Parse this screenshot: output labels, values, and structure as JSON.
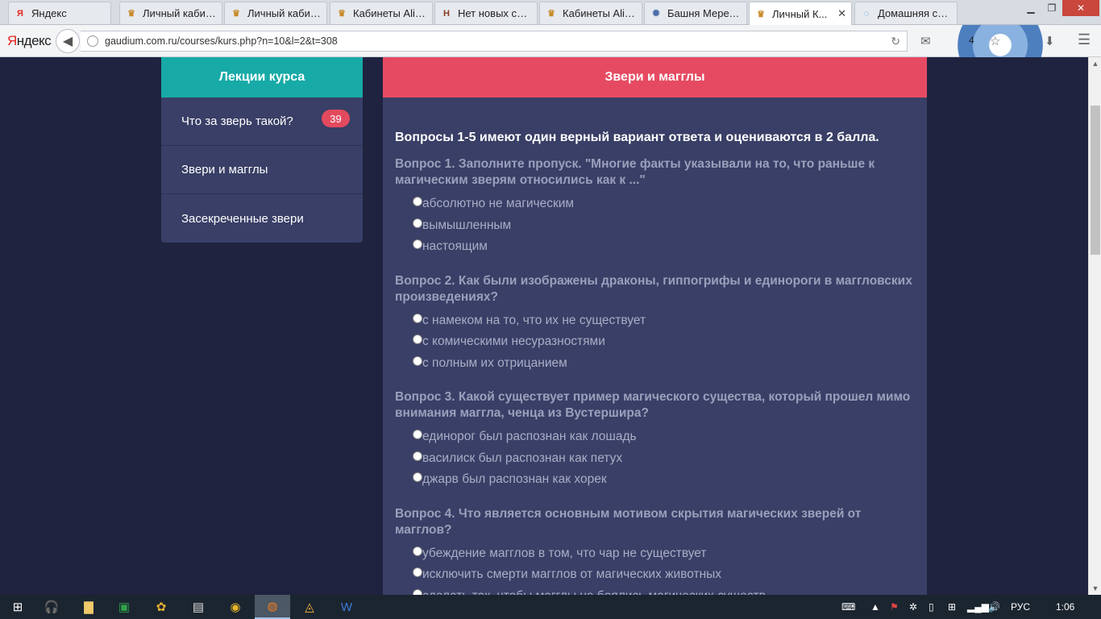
{
  "browser": {
    "tabs": [
      {
        "label": "Яндекс",
        "icon": "yandex-icon",
        "color": "#e52620",
        "glyph": "Я"
      },
      {
        "label": "Личный кабин...",
        "icon": "crest-icon",
        "color": "#c78a2a",
        "glyph": "♛"
      },
      {
        "label": "Личный кабин...",
        "icon": "crest-icon",
        "color": "#c78a2a",
        "glyph": "♛"
      },
      {
        "label": "Кабинеты Alic...",
        "icon": "crest-icon",
        "color": "#c78a2a",
        "glyph": "♛"
      },
      {
        "label": "Нет новых соо...",
        "icon": "shield-icon",
        "color": "#8a3a1e",
        "glyph": "H"
      },
      {
        "label": "Кабинеты Alic...",
        "icon": "crest-icon",
        "color": "#c78a2a",
        "glyph": "♛"
      },
      {
        "label": "Башня Меред...",
        "icon": "tower-icon",
        "color": "#4b6ea8",
        "glyph": "✺"
      },
      {
        "label": "Личный К...",
        "icon": "crest-icon",
        "color": "#c78a2a",
        "glyph": "♛",
        "active": true
      },
      {
        "label": "Домашняя стр...",
        "icon": "loading-icon",
        "color": "#3c8be0",
        "glyph": "◌"
      }
    ],
    "tab_close": "✕",
    "logo_first": "Я",
    "logo_rest": "ндекс",
    "url": "gaudium.com.ru/courses/kurs.php?n=10&l=2&t=308",
    "notification_count": "4"
  },
  "sidebar": {
    "title": "Лекции курса",
    "items": [
      {
        "label": "Что за зверь такой?",
        "badge": "39"
      },
      {
        "label": "Звери и магглы"
      },
      {
        "label": "Засекреченные звери"
      }
    ]
  },
  "main": {
    "title": "Звери и магглы",
    "intro": "Вопросы 1-5 имеют один верный вариант ответа и оцениваются в 2 балла.",
    "questions": [
      {
        "title": "Вопрос 1. Заполните пропуск. \"Многие факты указывали на то, что раньше к магическим зверям относились как к ...\"",
        "options": [
          "абсолютно не магическим",
          "вымышленным",
          "настоящим"
        ]
      },
      {
        "title": "Вопрос 2. Как были изображены драконы, гиппогрифы и единороги в маггловских произведениях?",
        "options": [
          "с намеком на то, что их не существует",
          "с комическими несуразностями",
          "с полным их отрицанием"
        ]
      },
      {
        "title": "Вопрос 3. Какой существует пример магического существа, который прошел мимо внимания маггла, ченца из Вустершира?",
        "options": [
          "единорог был распознан как лошадь",
          "василиск был распознан как петух",
          "джарв был распознан как хорек"
        ]
      },
      {
        "title": "Вопрос 4. Что является основным мотивом скрытия магических зверей от магглов?",
        "options": [
          "убеждение магглов в том, что чар не существует",
          "исключить смерти магглов от магических животных",
          "сделать так, чтобы магглы не боялись магических существ"
        ]
      }
    ]
  },
  "taskbar": {
    "language": "РУС",
    "time": "1:06"
  }
}
